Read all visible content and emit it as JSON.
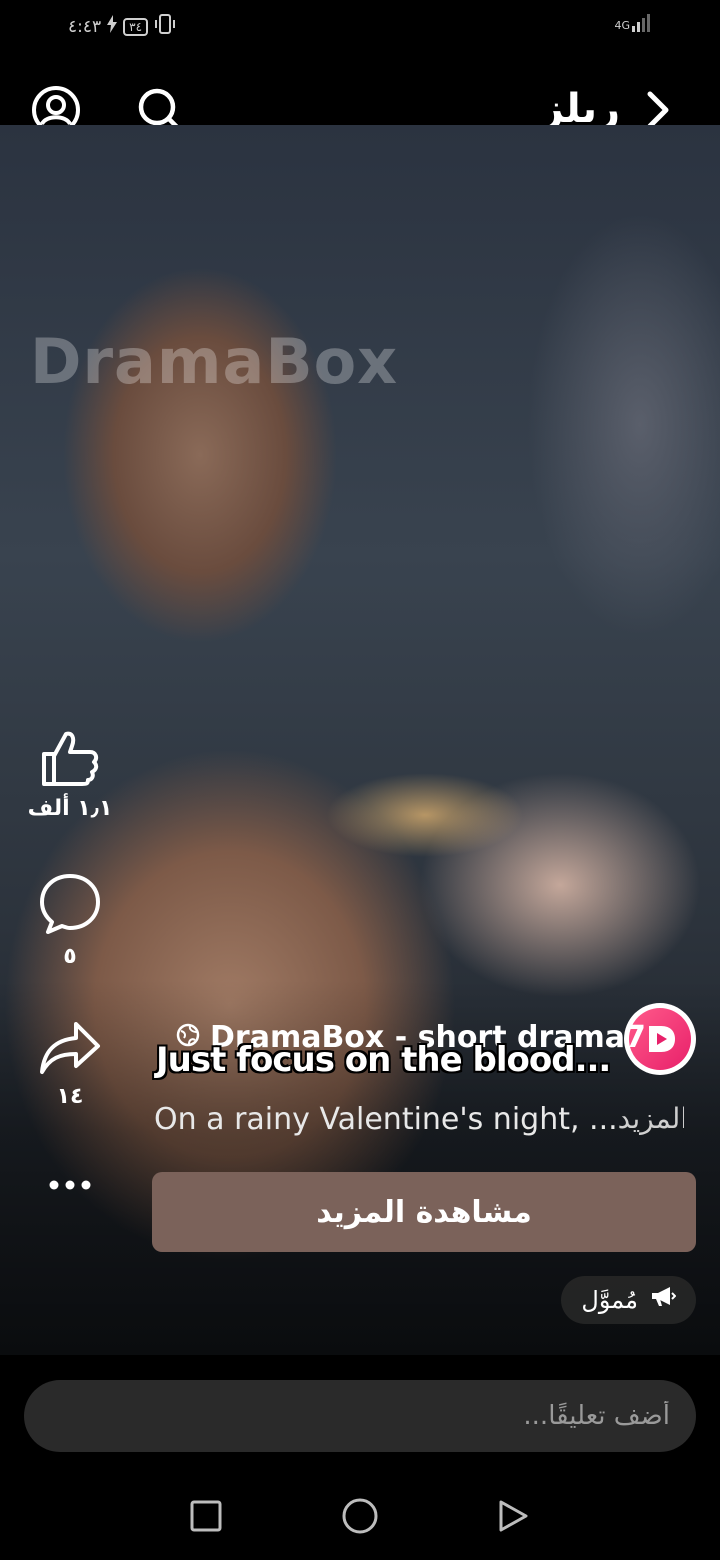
{
  "status_bar": {
    "time": "٤:٤٣",
    "battery": "٣٤",
    "network": "4G"
  },
  "header": {
    "title": "ريلز",
    "icons": [
      "profile-icon",
      "search-icon",
      "chevron-right-icon"
    ]
  },
  "video": {
    "watermark": "DramaBox",
    "subtitle": "Just focus on the blood..."
  },
  "actions": {
    "like_count": "١٫١ ألف",
    "comment_count": "٥",
    "share_count": "١٤",
    "icons": [
      "like-icon",
      "comment-icon",
      "share-icon",
      "more-icon"
    ]
  },
  "channel": {
    "name": "DramaBox - short drama7",
    "icon": "globe-icon"
  },
  "description": {
    "text": "On a rainy Valentine's night, ...",
    "more_label": "المزيد"
  },
  "cta": {
    "label": "مشاهدة المزيد"
  },
  "sponsored": {
    "label": "مُموَّل",
    "icon": "megaphone-icon"
  },
  "comment": {
    "placeholder": "أضف تعليقًا..."
  },
  "nav": {
    "icons": [
      "recents-icon",
      "home-icon",
      "back-icon"
    ]
  },
  "colors": {
    "cta_background": "#7b625a",
    "comment_box": "#2a2a2a",
    "avatar_gradient": "#e8206a"
  }
}
